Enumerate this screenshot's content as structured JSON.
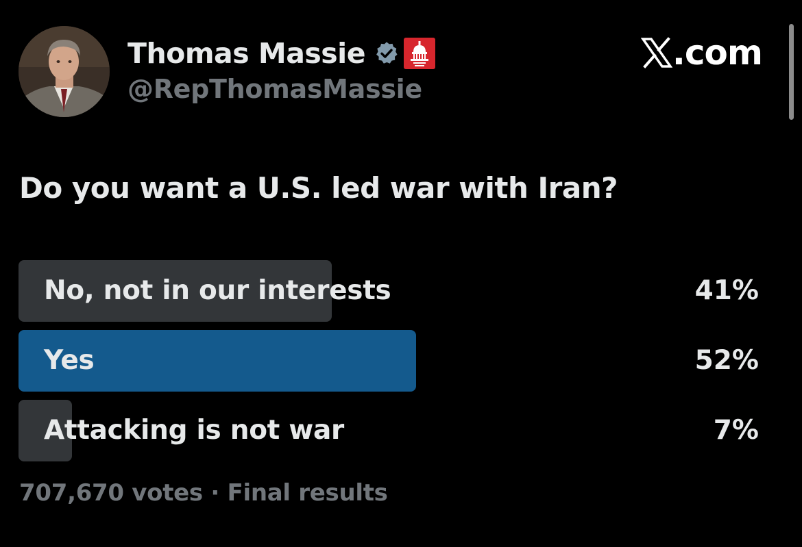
{
  "author": {
    "display_name": "Thomas Massie",
    "handle": "@RepThomasMassie",
    "avatar_icon": "portrait-avatar",
    "verified_icon": "verified-badge-icon",
    "affiliate_icon": "house-gop-capitol-icon"
  },
  "brand": {
    "logo_icon": "x-logo-icon",
    "suffix": ".com"
  },
  "poll": {
    "question": "Do you want a U.S. led war with Iran?",
    "options": [
      {
        "label": "No, not in our interests",
        "percent_text": "41%",
        "percent": 41,
        "leading": false
      },
      {
        "label": "Yes",
        "percent_text": "52%",
        "percent": 52,
        "leading": true
      },
      {
        "label": "Attacking is not war",
        "percent_text": "7%",
        "percent": 7,
        "leading": false
      }
    ],
    "footer": "707,670 votes · Final results"
  },
  "colors": {
    "background": "#000000",
    "bar_default": "#333639",
    "bar_leading": "#145a8d",
    "text_primary": "#e7e9ea",
    "text_secondary": "#71767b",
    "verified_badge": "#829aab",
    "affiliate_badge": "#d7262d"
  }
}
